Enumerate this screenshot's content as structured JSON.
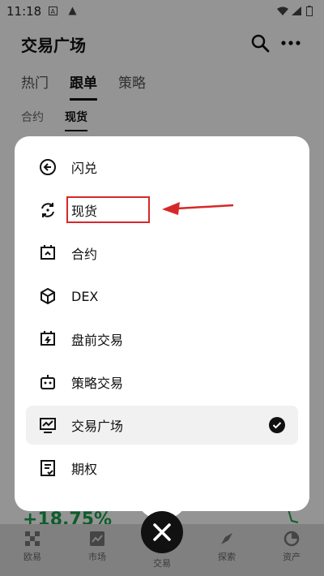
{
  "status_bar": {
    "time": "11:18"
  },
  "header": {
    "title": "交易广场"
  },
  "tabs": [
    {
      "label": "热门",
      "active": false
    },
    {
      "label": "跟单",
      "active": true
    },
    {
      "label": "策略",
      "active": false
    }
  ],
  "subtabs": [
    {
      "label": "合约",
      "active": false
    },
    {
      "label": "现货",
      "active": true
    }
  ],
  "background": {
    "percent_text": "+18.75%"
  },
  "menu": {
    "items": [
      {
        "label": "闪兑",
        "icon": "swap-circle-icon"
      },
      {
        "label": "现货",
        "icon": "refresh-circle-icon",
        "highlighted": true
      },
      {
        "label": "合约",
        "icon": "contract-icon"
      },
      {
        "label": "DEX",
        "icon": "cube-icon"
      },
      {
        "label": "盘前交易",
        "icon": "calendar-flash-icon"
      },
      {
        "label": "策略交易",
        "icon": "robot-icon"
      },
      {
        "label": "交易广场",
        "icon": "chart-screen-icon",
        "selected": true
      },
      {
        "label": "期权",
        "icon": "options-doc-icon"
      }
    ]
  },
  "bottom_nav": [
    {
      "label": "欧易",
      "icon": "okx-logo-icon"
    },
    {
      "label": "市场",
      "icon": "market-chart-icon"
    },
    {
      "label": "交易",
      "icon": "close-icon"
    },
    {
      "label": "探索",
      "icon": "compass-icon"
    },
    {
      "label": "资产",
      "icon": "pie-chart-icon"
    }
  ],
  "colors": {
    "accent_red": "#d62828",
    "dark": "#111111",
    "green": "#19a04a"
  }
}
